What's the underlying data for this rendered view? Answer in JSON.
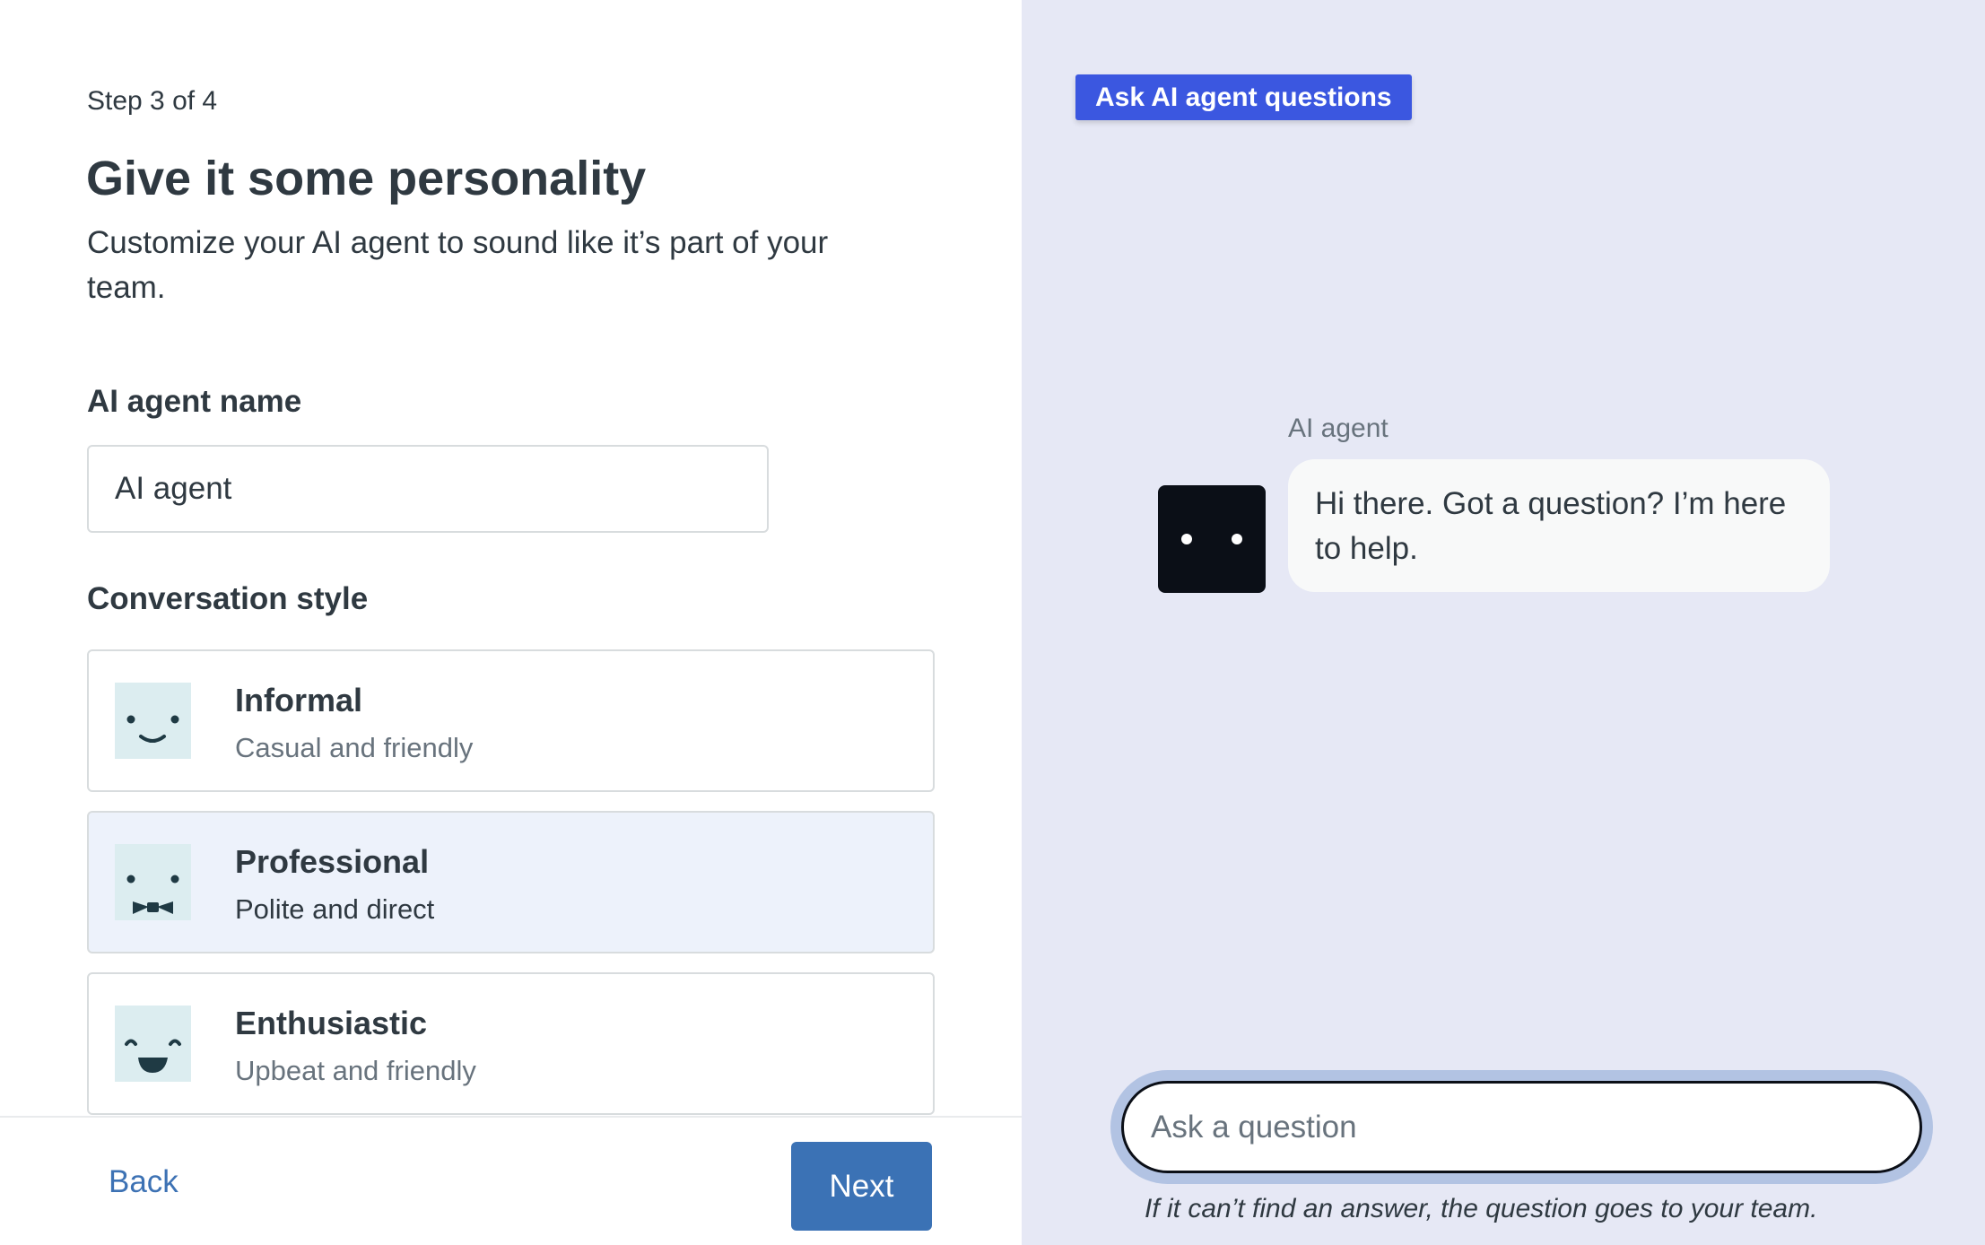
{
  "wizard": {
    "step": "Step 3 of 4",
    "title": "Give it some personality",
    "subtitle": "Customize your AI agent to sound like it’s part of your team."
  },
  "name_field": {
    "label": "AI agent name",
    "value": "AI agent"
  },
  "style": {
    "label": "Conversation style",
    "options": [
      {
        "title": "Informal",
        "description": "Casual and friendly",
        "icon": "smile-face-icon",
        "selected": false
      },
      {
        "title": "Professional",
        "description": "Polite and direct",
        "icon": "bowtie-face-icon",
        "selected": true
      },
      {
        "title": "Enthusiastic",
        "description": "Upbeat and friendly",
        "icon": "grin-face-icon",
        "selected": false
      }
    ]
  },
  "footer": {
    "back_label": "Back",
    "next_label": "Next"
  },
  "preview": {
    "badge": "Ask AI agent questions",
    "agent_name": "AI agent",
    "avatar_icon": "bot-avatar-icon",
    "message": "Hi there. Got a question? I’m here to help.",
    "input_placeholder": "Ask a question",
    "hint": "If it can’t find an answer, the question goes to your team."
  },
  "colors": {
    "primary": "#3b72b5",
    "badge": "#3b57e0",
    "preview_bg": "#e6e8f5",
    "selected_bg": "#edf2fb",
    "face_bg": "#dcedf0"
  }
}
